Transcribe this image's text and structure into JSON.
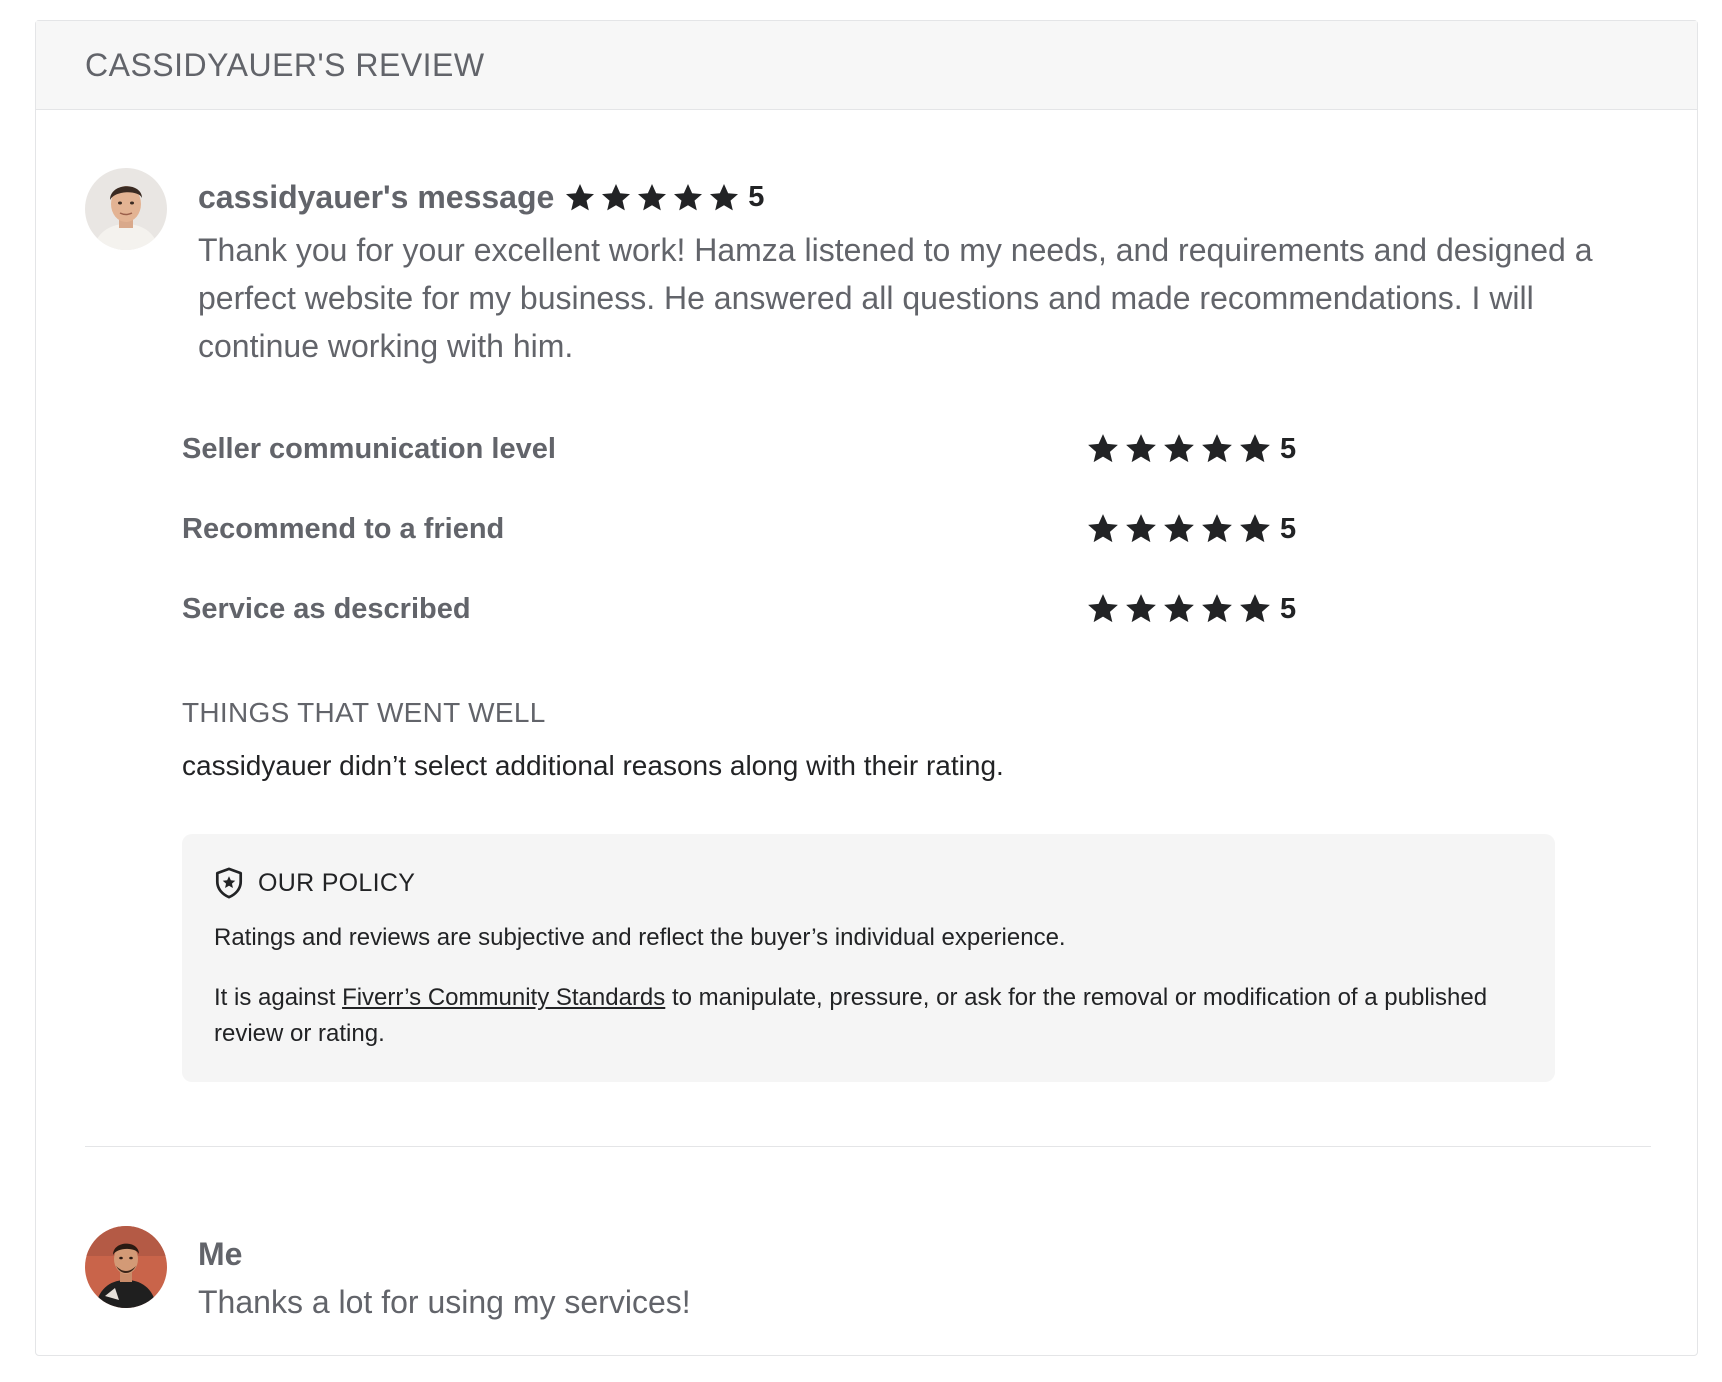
{
  "review": {
    "title": "CASSIDYAUER'S REVIEW",
    "buyer": {
      "message_label": "cassidyauer's message",
      "rating": "5",
      "message": "Thank you for your excellent work! Hamza listened to my needs, and requirements and designed a perfect website for my business. He answered all questions and made recommendations. I will continue working with him."
    },
    "ratings": [
      {
        "label": "Seller communication level",
        "value": "5",
        "stars": 5
      },
      {
        "label": "Recommend to a friend",
        "value": "5",
        "stars": 5
      },
      {
        "label": "Service as described",
        "value": "5",
        "stars": 5
      }
    ],
    "things_went_well": {
      "title": "THINGS THAT WENT WELL",
      "text": "cassidyauer didn’t select additional reasons along with their rating."
    },
    "policy": {
      "icon": "shield-star-icon",
      "title": "OUR POLICY",
      "paragraph1": "Ratings and reviews are subjective and reflect the buyer’s individual experience.",
      "paragraph2_before": "It is against ",
      "paragraph2_link": "Fiverr’s Community Standards",
      "paragraph2_after": " to manipulate, pressure, or ask for the removal or modification of a published review or rating."
    },
    "reply": {
      "name": "Me",
      "text": "Thanks a lot for using my services!"
    }
  },
  "colors": {
    "text_primary": "#222325",
    "text_secondary": "#62646a",
    "star": "#222325",
    "header_bg": "#f7f7f7",
    "policy_bg": "#f5f5f5",
    "border": "#e4e5e7"
  }
}
